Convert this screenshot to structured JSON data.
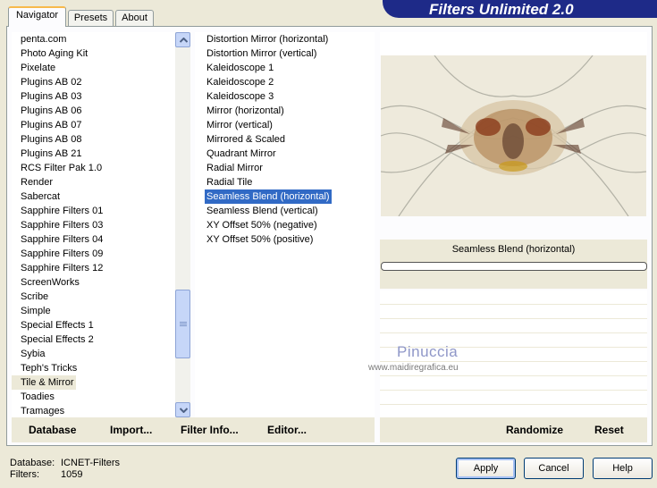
{
  "tabs": [
    {
      "label": "Navigator"
    },
    {
      "label": "Presets"
    },
    {
      "label": "About"
    }
  ],
  "app": {
    "title": "Filters Unlimited 2.0"
  },
  "categories": [
    "penta.com",
    "Photo Aging Kit",
    "Pixelate",
    "Plugins AB 02",
    "Plugins AB 03",
    "Plugins AB 06",
    "Plugins AB 07",
    "Plugins AB 08",
    "Plugins AB 21",
    "RCS Filter Pak 1.0",
    "Render",
    "Sabercat",
    "Sapphire Filters 01",
    "Sapphire Filters 03",
    "Sapphire Filters 04",
    "Sapphire Filters 09",
    "Sapphire Filters 12",
    "ScreenWorks",
    "Scribe",
    "Simple",
    "Special Effects 1",
    "Special Effects 2",
    "Sybia",
    "Teph's Tricks",
    "Tile & Mirror",
    "Toadies",
    "Tramages"
  ],
  "selected_category": "Tile & Mirror",
  "filters": [
    "Distortion Mirror (horizontal)",
    "Distortion Mirror (vertical)",
    "Kaleidoscope 1",
    "Kaleidoscope 2",
    "Kaleidoscope 3",
    "Mirror (horizontal)",
    "Mirror (vertical)",
    "Mirrored & Scaled",
    "Quadrant Mirror",
    "Radial Mirror",
    "Radial Tile",
    "Seamless Blend (horizontal)",
    "Seamless Blend (vertical)",
    "XY Offset 50% (negative)",
    "XY Offset 50% (positive)"
  ],
  "selected_filter": "Seamless Blend (horizontal)",
  "preview": {
    "filter_name": "Seamless Blend (horizontal)",
    "watermark_name": "Pinuccia",
    "watermark_url": "www.maidiregrafica.eu"
  },
  "toolbar": {
    "database": "Database",
    "import": "Import...",
    "filter_info": "Filter Info...",
    "editor": "Editor...",
    "randomize": "Randomize",
    "reset": "Reset"
  },
  "status": {
    "database_label": "Database:",
    "database_value": "ICNET-Filters",
    "filters_label": "Filters:",
    "filters_value": "1059"
  },
  "buttons": {
    "apply": "Apply",
    "cancel": "Cancel",
    "help": "Help"
  },
  "colors": {
    "banner": "#1e2a88",
    "selection": "#316ac5",
    "tab_highlight": "#f7b94b"
  }
}
